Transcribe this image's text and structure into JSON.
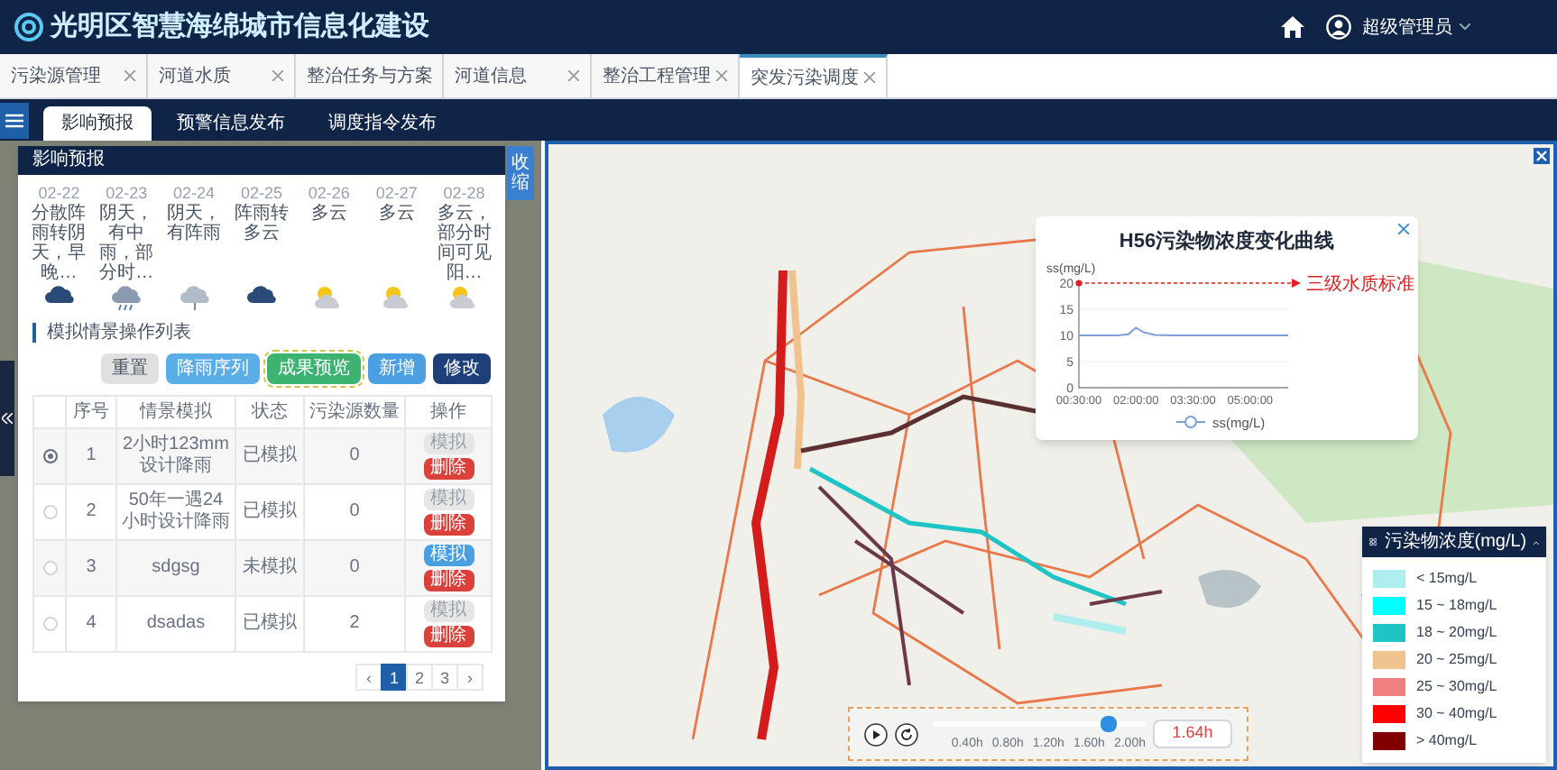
{
  "header": {
    "title": "光明区智慧海绵城市信息化建设",
    "user": "超级管理员"
  },
  "tabs": [
    {
      "label": "污染源管理",
      "selected": false
    },
    {
      "label": "河道水质",
      "selected": false
    },
    {
      "label": "整治任务与方案",
      "selected": false
    },
    {
      "label": "河道信息",
      "selected": false
    },
    {
      "label": "整治工程管理",
      "selected": false
    },
    {
      "label": "突发污染调度",
      "selected": true
    }
  ],
  "subtabs": [
    {
      "label": "影响预报",
      "selected": true
    },
    {
      "label": "预警信息发布",
      "selected": false
    },
    {
      "label": "调度指令发布",
      "selected": false
    }
  ],
  "panel": {
    "title": "影响预报",
    "collapse_label": "收缩",
    "forecast": [
      {
        "date": "02-22",
        "desc": "分散阵雨转阴天，早晚…",
        "kind": "cloud"
      },
      {
        "date": "02-23",
        "desc": "阴天，有中雨，部分时…",
        "kind": "storm"
      },
      {
        "date": "02-24",
        "desc": "阴天，有阵雨",
        "kind": "rain"
      },
      {
        "date": "02-25",
        "desc": "阵雨转多云",
        "kind": "cloud"
      },
      {
        "date": "02-26",
        "desc": "多云",
        "kind": "sun_cloud"
      },
      {
        "date": "02-27",
        "desc": "多云",
        "kind": "sun_cloud"
      },
      {
        "date": "02-28",
        "desc": "多云，部分时间可见阳…",
        "kind": "sun_cloud"
      }
    ],
    "section_title": "模拟情景操作列表",
    "buttons": [
      {
        "label": "重置",
        "kind": "default",
        "focused": false
      },
      {
        "label": "降雨序列",
        "kind": "info",
        "focused": false
      },
      {
        "label": "成果预览",
        "kind": "success",
        "focused": true
      },
      {
        "label": "新增",
        "kind": "primary",
        "focused": false
      },
      {
        "label": "修改",
        "kind": "dark",
        "focused": false
      }
    ],
    "table": {
      "columns": [
        "序号",
        "情景模拟",
        "状态",
        "污染源数量",
        "操作"
      ],
      "rows": [
        {
          "selected": true,
          "index": "1",
          "scenario": "2小时123mm设计降雨",
          "status": "已模拟",
          "count": "0",
          "simulate": {
            "label": "模拟",
            "disabled": true
          },
          "delete": "删除"
        },
        {
          "selected": false,
          "index": "2",
          "scenario": "50年一遇24小时设计降雨",
          "status": "已模拟",
          "count": "0",
          "simulate": {
            "label": "模拟",
            "disabled": true
          },
          "delete": "删除"
        },
        {
          "selected": false,
          "index": "3",
          "scenario": "sdgsg",
          "status": "未模拟",
          "count": "0",
          "simulate": {
            "label": "模拟",
            "disabled": false
          },
          "delete": "删除"
        },
        {
          "selected": false,
          "index": "4",
          "scenario": "dsadas",
          "status": "已模拟",
          "count": "2",
          "simulate": {
            "label": "模拟",
            "disabled": true
          },
          "delete": "删除"
        }
      ]
    },
    "pagination": [
      {
        "label": "‹",
        "selected": false
      },
      {
        "label": "1",
        "selected": true
      },
      {
        "label": "2",
        "selected": false
      },
      {
        "label": "3",
        "selected": false
      },
      {
        "label": "›",
        "selected": false
      }
    ]
  },
  "chart_popup": {
    "chart_data": {
      "type": "line",
      "title": "H56污染物浓度变化曲线",
      "ylabel": "ss(mg/L)",
      "x": [
        0.5,
        1,
        1.5,
        1.8,
        2,
        2.2,
        2.5,
        3,
        3.5,
        4,
        4.5,
        5,
        5.5,
        6
      ],
      "series": [
        {
          "name": "ss(mg/L)",
          "color": "#7b9fd6",
          "values": [
            10,
            10,
            10,
            10.2,
            11.5,
            10.6,
            10.1,
            10,
            10,
            10,
            10,
            10,
            10,
            10
          ]
        }
      ],
      "xlim": [
        0.5,
        6
      ],
      "ylim": [
        0,
        20
      ],
      "xticks": [
        {
          "value": 0.5,
          "label": "00:30:00"
        },
        {
          "value": 2,
          "label": "02:00:00"
        },
        {
          "value": 3.5,
          "label": "03:30:00"
        },
        {
          "value": 5,
          "label": "05:00:00"
        }
      ],
      "yticks": [
        0,
        5,
        10,
        15,
        20
      ],
      "grid": true,
      "ref_lines": [
        {
          "axis": "y",
          "value": 20,
          "label": "三级水质标准",
          "color": "#e02020"
        }
      ]
    }
  },
  "legend": {
    "title": "污染物浓度(mg/L)",
    "expanded": true,
    "items": [
      {
        "label": "< 15mg/L",
        "color": "#aeeeee"
      },
      {
        "label": "15 ~ 18mg/L",
        "color": "#00ffff"
      },
      {
        "label": "18 ~ 20mg/L",
        "color": "#1fc4c4"
      },
      {
        "label": "20 ~ 25mg/L",
        "color": "#f0c38e"
      },
      {
        "label": "25 ~ 30mg/L",
        "color": "#f08080"
      },
      {
        "label": "30 ~ 40mg/L",
        "color": "#ff0000"
      },
      {
        "label": "> 40mg/L",
        "color": "#800000"
      }
    ]
  },
  "timeline": {
    "ticks": [
      "0.40h",
      "0.80h",
      "1.20h",
      "1.60h",
      "2.00h"
    ],
    "level": 0.82,
    "readout": "1.64h"
  }
}
